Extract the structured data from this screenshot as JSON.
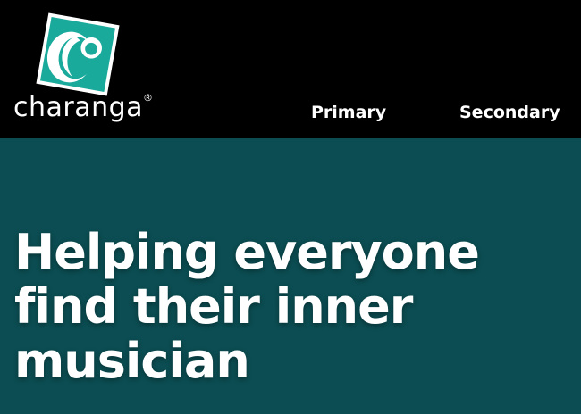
{
  "colors": {
    "header_bg": "#000000",
    "hero_bg": "#0b4d52",
    "logo_accent": "#1aaa9c",
    "text": "#ffffff"
  },
  "logo": {
    "wordmark": "charanga",
    "registered_mark": "®",
    "icon": "charanga-c-logo-icon"
  },
  "nav": {
    "primary_label": "Primary",
    "secondary_label": "Secondary"
  },
  "hero": {
    "title_lines": [
      "Helping everyone",
      "find their inner",
      "musician"
    ]
  }
}
